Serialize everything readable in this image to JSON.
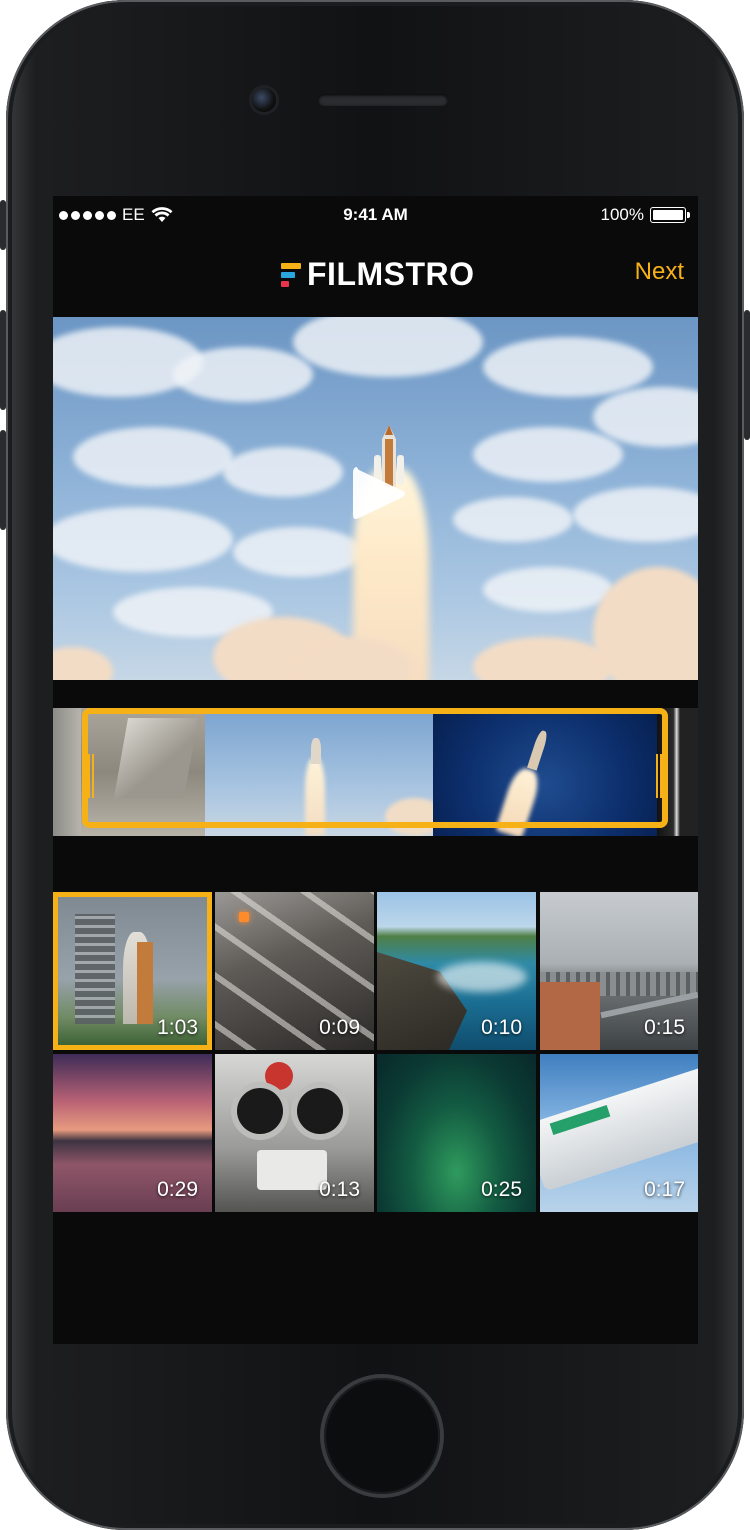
{
  "status_bar": {
    "carrier": "EE",
    "time": "9:41 AM",
    "battery_percent": "100%"
  },
  "nav": {
    "logo_text": "FILMSTRO",
    "next_label": "Next"
  },
  "video": {
    "play_icon": "play-icon"
  },
  "clips": [
    {
      "duration": "1:03",
      "selected": true,
      "scene": "launch-pad"
    },
    {
      "duration": "0:09",
      "selected": false,
      "scene": "mixing-desk"
    },
    {
      "duration": "0:10",
      "selected": false,
      "scene": "coastline"
    },
    {
      "duration": "0:15",
      "selected": false,
      "scene": "city-highway"
    },
    {
      "duration": "0:29",
      "selected": false,
      "scene": "sunset-lake"
    },
    {
      "duration": "0:13",
      "selected": false,
      "scene": "binocular-viewer"
    },
    {
      "duration": "0:25",
      "selected": false,
      "scene": "aurora"
    },
    {
      "duration": "0:17",
      "selected": false,
      "scene": "airplane-wing"
    }
  ],
  "colors": {
    "accent": "#f6b117",
    "screen_bg": "#0a0a0b",
    "logo_red": "#e8334a",
    "logo_yellow": "#f6b117",
    "logo_blue": "#2aa6df"
  }
}
